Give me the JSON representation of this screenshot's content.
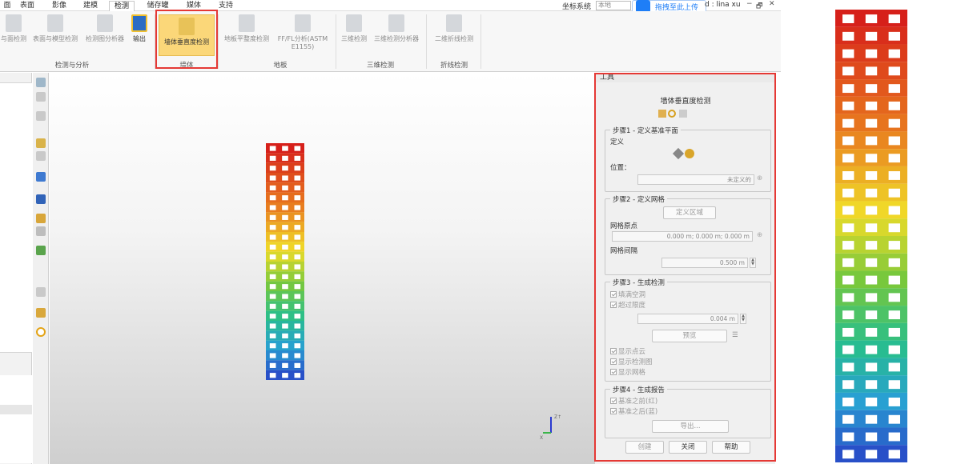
{
  "menu": {
    "tabs": [
      {
        "label": "面",
        "active": false
      },
      {
        "label": "表面",
        "active": false
      },
      {
        "label": "影像",
        "active": false
      },
      {
        "label": "建模",
        "active": false
      },
      {
        "label": "检测",
        "active": true
      },
      {
        "label": "储存罐",
        "active": false
      },
      {
        "label": "媒体",
        "active": false
      },
      {
        "label": "支持",
        "active": false
      }
    ],
    "coord_system_label": "坐标系统",
    "coord_system_value": "本地",
    "upload_label": "拖拽至此上传",
    "user_label": "d : lina xu",
    "window_controls": [
      "−",
      "🗗",
      "✕"
    ]
  },
  "ribbon": {
    "buttons": [
      {
        "label": "与面检测",
        "enabled": false
      },
      {
        "label": "表面与模型检测",
        "enabled": false
      },
      {
        "label": "检测图分析器",
        "enabled": false
      },
      {
        "label": "输出",
        "enabled": true
      },
      {
        "label": "墙体垂直度检测",
        "enabled": true,
        "highlight": true
      },
      {
        "label": "地板平整度检测",
        "enabled": false
      },
      {
        "label": "FF/FL分析(ASTM E1155)",
        "enabled": false
      },
      {
        "label": "三维检测",
        "enabled": false
      },
      {
        "label": "三维检测分析器",
        "enabled": false
      },
      {
        "label": "二维折线检测",
        "enabled": false
      }
    ],
    "groups": [
      "检测与分析",
      "墙体",
      "地板",
      "三维检测",
      "折线检测"
    ]
  },
  "tool_panel": {
    "header": "工具",
    "title": "墙体垂直度检测",
    "step1": {
      "legend": "步骤1 - 定义基准平面",
      "define_label": "定义",
      "position_label": "位置：",
      "position_value": "未定义的"
    },
    "step2": {
      "legend": "步骤2 - 定义网格",
      "define_area_btn": "定义区域",
      "origin_label": "网格原点",
      "origin_value": "0.000 m; 0.000 m; 0.000 m",
      "spacing_label": "网格间隔",
      "spacing_value": "0.500 m"
    },
    "step3": {
      "legend": "步骤3 - 生成检测",
      "fill_holes": "填满空洞",
      "over_limit": "超过限度",
      "limit_value": "0.004 m",
      "preview_btn": "预览",
      "show_cloud": "显示点云",
      "show_map": "显示检测图",
      "show_grid": "显示网格"
    },
    "step4": {
      "legend": "步骤4 - 生成报告",
      "before_ref": "基准之前(红)",
      "after_ref": "基准之后(蓝)",
      "export_btn": "导出..."
    },
    "footer": {
      "create": "创建",
      "close": "关闭",
      "help": "帮助"
    }
  },
  "viewport": {
    "axis_labels": {
      "z": "Z↑",
      "x": "X"
    }
  },
  "colors": {
    "highlight": "#fbd779",
    "annotation_red": "#e53935",
    "accent_blue": "#1e7ef7"
  }
}
